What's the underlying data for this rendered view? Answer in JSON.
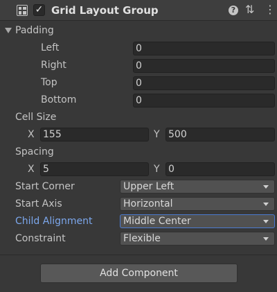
{
  "header": {
    "component_title": "Grid Layout Group",
    "enabled_check": "✓",
    "help_glyph": "?",
    "preset_glyph": "⇅",
    "menu_glyph": "⋮"
  },
  "padding": {
    "label": "Padding",
    "left": {
      "label": "Left",
      "value": "0"
    },
    "right": {
      "label": "Right",
      "value": "0"
    },
    "top": {
      "label": "Top",
      "value": "0"
    },
    "bottom": {
      "label": "Bottom",
      "value": "0"
    }
  },
  "cell_size": {
    "label": "Cell Size",
    "x_label": "X",
    "x_value": "155",
    "y_label": "Y",
    "y_value": "500"
  },
  "spacing": {
    "label": "Spacing",
    "x_label": "X",
    "x_value": "5",
    "y_label": "Y",
    "y_value": "0"
  },
  "start_corner": {
    "label": "Start Corner",
    "value": "Upper Left"
  },
  "start_axis": {
    "label": "Start Axis",
    "value": "Horizontal"
  },
  "child_alignment": {
    "label": "Child Alignment",
    "value": "Middle Center"
  },
  "constraint": {
    "label": "Constraint",
    "value": "Flexible"
  },
  "add_component_label": "Add Component",
  "colors": {
    "background": "#383838",
    "field": "#2a2a2a",
    "dropdown": "#515151",
    "highlight_label": "#7ca7ec",
    "focus_border": "#4b7ad1"
  }
}
